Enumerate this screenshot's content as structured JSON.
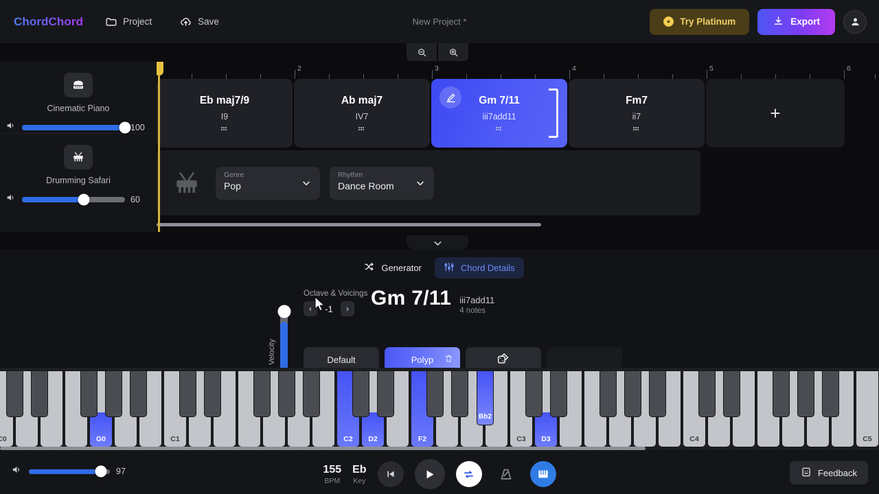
{
  "header": {
    "logo": "ChordChord",
    "project_label": "Project",
    "save_label": "Save",
    "project_title": "New Project *",
    "platinum_label": "Try Platinum",
    "export_label": "Export",
    "accent_blue": "#2f6ce5",
    "gold": "#f0cf6a"
  },
  "timeline": {
    "bar_numbers": [
      "2",
      "3",
      "4",
      "5",
      "6"
    ],
    "chords": [
      {
        "name": "Eb maj7/9",
        "degree": "I9",
        "selected": false
      },
      {
        "name": "Ab maj7",
        "degree": "IV7",
        "selected": false
      },
      {
        "name": "Gm 7/11",
        "degree": "iii7add11",
        "selected": true
      },
      {
        "name": "Fm7",
        "degree": "ii7",
        "selected": false
      }
    ],
    "add_label": "+",
    "genre": {
      "label": "Genre",
      "value": "Pop"
    },
    "rhythm": {
      "label": "Rhythm",
      "value": "Dance Room"
    }
  },
  "tracks": [
    {
      "name": "Cinematic Piano",
      "volume": "100",
      "volume_pct": 100,
      "icon": "piano-icon"
    },
    {
      "name": "Drumming Safari",
      "volume": "60",
      "volume_pct": 60,
      "icon": "drum-icon"
    }
  ],
  "detail": {
    "tabs": [
      {
        "label": "Generator",
        "icon": "shuffle-icon",
        "active": false
      },
      {
        "label": "Chord Details",
        "icon": "sliders-icon",
        "active": true
      }
    ],
    "velocity_label": "Velocity",
    "velocity_pct": 88,
    "octave_title": "Octave & Voicings",
    "octave_value": "-1",
    "prev_label": "‹",
    "next_label": "›",
    "chord_name": "Gm 7/11",
    "chord_degree": "iii7add11",
    "chord_notes": "4 notes",
    "voicings": [
      {
        "label": "Default",
        "selected": false,
        "type": "text"
      },
      {
        "label": "Polyp",
        "selected": true,
        "type": "text"
      },
      {
        "label": "",
        "selected": false,
        "type": "dice"
      },
      {
        "label": "",
        "selected": false,
        "type": "empty"
      },
      {
        "label": "",
        "selected": false,
        "type": "empty"
      },
      {
        "label": "",
        "selected": false,
        "type": "empty"
      },
      {
        "label": "",
        "selected": false,
        "type": "empty"
      },
      {
        "label": "",
        "selected": false,
        "type": "empty"
      }
    ]
  },
  "piano": {
    "octave_labels": [
      "C0",
      "C1",
      "C2",
      "C3",
      "C4",
      "C5"
    ],
    "highlighted": [
      "G0",
      "C2",
      "D2",
      "F2",
      "Bb2",
      "D3"
    ],
    "key_labels": {
      "G0": "G0",
      "C2": "C2",
      "D2": "D2",
      "F2": "F2",
      "Bb2": "Bb2",
      "D3": "D3"
    }
  },
  "transport": {
    "master_volume": "97",
    "master_volume_pct": 89,
    "bpm_value": "155",
    "bpm_label": "BPM",
    "key_value": "Eb",
    "key_label": "Key",
    "rewind": "rewind-button",
    "play": "play-button",
    "loop": "loop-button",
    "metronome": "metronome-button",
    "keyboard_toggle": "keyboard-toggle-button",
    "feedback_label": "Feedback"
  }
}
